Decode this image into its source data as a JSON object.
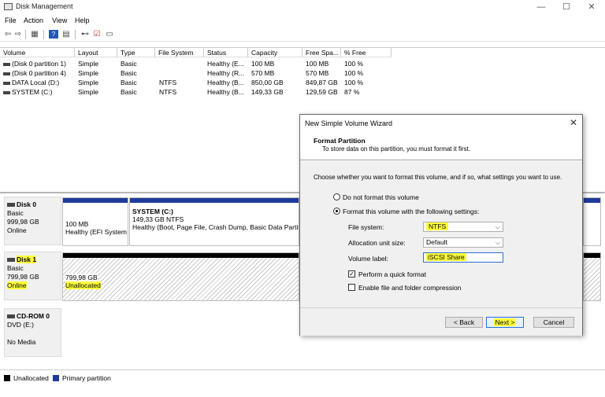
{
  "window": {
    "title": "Disk Management",
    "controls": [
      "—",
      "☐",
      "✕"
    ]
  },
  "menu": [
    "File",
    "Action",
    "View",
    "Help"
  ],
  "volume_list": {
    "headers": [
      "Volume",
      "Layout",
      "Type",
      "File System",
      "Status",
      "Capacity",
      "Free Spa...",
      "% Free"
    ],
    "rows": [
      [
        "(Disk 0 partition 1)",
        "Simple",
        "Basic",
        "",
        "Healthy (E...",
        "100 MB",
        "100 MB",
        "100 %"
      ],
      [
        "(Disk 0 partition 4)",
        "Simple",
        "Basic",
        "",
        "Healthy (R...",
        "570 MB",
        "570 MB",
        "100 %"
      ],
      [
        "DATA Local (D:)",
        "Simple",
        "Basic",
        "NTFS",
        "Healthy (B...",
        "850,00 GB",
        "849,87 GB",
        "100 %"
      ],
      [
        "SYSTEM (C:)",
        "Simple",
        "Basic",
        "NTFS",
        "Healthy (B...",
        "149,33 GB",
        "129,59 GB",
        "87 %"
      ]
    ]
  },
  "disks": {
    "disk0": {
      "name": "Disk 0",
      "type": "Basic",
      "size": "999,98 GB",
      "status": "Online",
      "p1": {
        "size": "100 MB",
        "status": "Healthy (EFI System"
      },
      "p2": {
        "name": "SYSTEM (C:)",
        "size": "149,33 GB NTFS",
        "status": "Healthy (Boot, Page File, Crash Dump, Basic Data Partiti"
      }
    },
    "disk1": {
      "name": "Disk 1",
      "type": "Basic",
      "size": "799,98 GB",
      "status": "Online",
      "p1": {
        "size": "799,98 GB",
        "status": "Unallocated"
      }
    },
    "cdrom": {
      "name": "CD-ROM 0",
      "type": "DVD (E:)",
      "status": "No Media"
    }
  },
  "legend": [
    "Unallocated",
    "Primary partition"
  ],
  "dialog": {
    "title": "New Simple Volume Wizard",
    "header_title": "Format Partition",
    "header_sub": "To store data on this partition, you must format it first.",
    "prompt": "Choose whether you want to format this volume, and if so, what settings you want to use.",
    "opt_no": "Do not format this volume",
    "opt_yes": "Format this volume with the following settings:",
    "fs_label": "File system:",
    "fs_value": "NTFS",
    "au_label": "Allocation unit size:",
    "au_value": "Default",
    "vl_label": "Volume label:",
    "vl_value": "iSCSI Share",
    "quick": "Perform a quick format",
    "compress": "Enable file and folder compression",
    "back": "< Back",
    "next": "Next >",
    "cancel": "Cancel"
  },
  "colors": {
    "primary": "#1f3a9c",
    "highlight": "#ffff3b",
    "unallocated": "#000000"
  }
}
